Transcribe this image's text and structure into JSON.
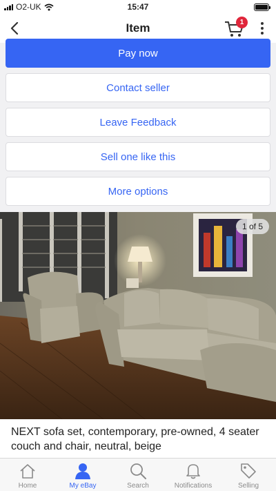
{
  "status_bar": {
    "carrier": "O2-UK",
    "time": "15:47"
  },
  "nav": {
    "title": "Item",
    "cart_count": "1"
  },
  "actions": {
    "pay_now": "Pay now",
    "contact_seller": "Contact seller",
    "leave_feedback": "Leave Feedback",
    "sell_one": "Sell one like this",
    "more_options": "More options"
  },
  "gallery": {
    "counter": "1 of 5"
  },
  "listing": {
    "title": "NEXT sofa set, contemporary, pre-owned, 4 seater couch and chair, neutral, beige"
  },
  "tabs": [
    {
      "label": "Home",
      "icon": "home-icon"
    },
    {
      "label": "My eBay",
      "icon": "user-icon",
      "active": true
    },
    {
      "label": "Search",
      "icon": "search-icon"
    },
    {
      "label": "Notifications",
      "icon": "bell-icon"
    },
    {
      "label": "Selling",
      "icon": "tag-icon"
    }
  ],
  "colors": {
    "accent": "#3665f3",
    "badge": "#e0263b",
    "active_tab": "#3665f3"
  }
}
